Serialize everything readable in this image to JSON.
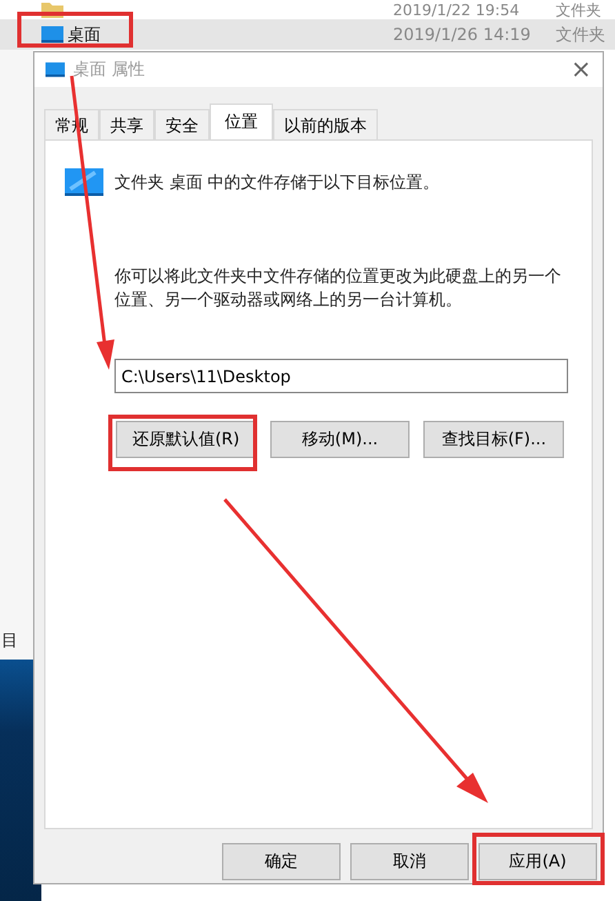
{
  "explorer": {
    "rows": [
      {
        "name": "",
        "date": "2019/1/22 19:54",
        "type": "文件夹",
        "selected": false
      },
      {
        "name": "桌面",
        "date": "2019/1/26 14:19",
        "type": "文件夹",
        "selected": true
      }
    ],
    "sidebar_text": "目"
  },
  "dialog": {
    "title": "桌面 属性",
    "close": "×",
    "tabs": [
      {
        "label": "常规",
        "selected": false
      },
      {
        "label": "共享",
        "selected": false
      },
      {
        "label": "安全",
        "selected": false
      },
      {
        "label": "位置",
        "selected": true
      },
      {
        "label": "以前的版本",
        "selected": false
      }
    ],
    "info": "文件夹 桌面 中的文件存储于以下目标位置。",
    "description": "你可以将此文件夹中文件存储的位置更改为此硬盘上的另一个位置、另一个驱动器或网络上的另一台计算机。",
    "path": "C:\\Users\\11\\Desktop",
    "actions": [
      "还原默认值(R)",
      "移动(M)...",
      "查找目标(F)..."
    ],
    "buttons": [
      "确定",
      "取消",
      "应用(A)"
    ]
  }
}
